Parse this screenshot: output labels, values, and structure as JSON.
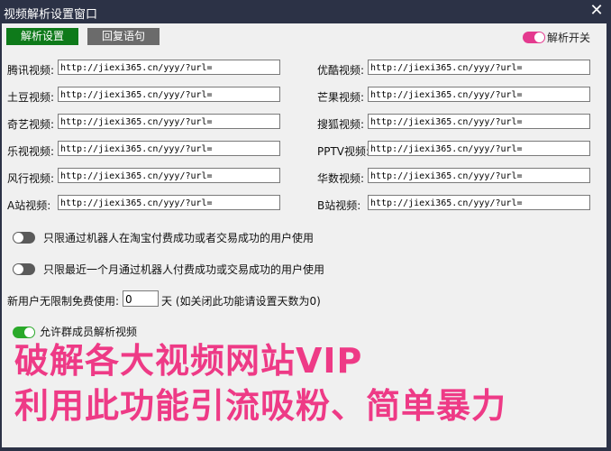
{
  "window": {
    "title": "视频解析设置窗口",
    "close_glyph": "✕"
  },
  "toolbar": {
    "tab_parse": "解析设置",
    "tab_reply": "回复语句",
    "toggle_label": "解析开关"
  },
  "rows": [
    {
      "left_label": "腾讯视频:",
      "left_value": "http://jiexi365.cn/yyy/?url=",
      "right_label": "优酷视频:",
      "right_value": "http://jiexi365.cn/yyy/?url="
    },
    {
      "left_label": "土豆视频:",
      "left_value": "http://jiexi365.cn/yyy/?url=",
      "right_label": "芒果视频:",
      "right_value": "http://jiexi365.cn/yyy/?url="
    },
    {
      "left_label": "奇艺视频:",
      "left_value": "http://jiexi365.cn/yyy/?url=",
      "right_label": "搜狐视频:",
      "right_value": "http://jiexi365.cn/yyy/?url="
    },
    {
      "left_label": "乐视视频:",
      "left_value": "http://jiexi365.cn/yyy/?url=",
      "right_label": "PPTV视频:",
      "right_value": "http://jiexi365.cn/yyy/?url="
    },
    {
      "left_label": "风行视频:",
      "left_value": "http://jiexi365.cn/yyy/?url=",
      "right_label": "华数视频:",
      "right_value": "http://jiexi365.cn/yyy/?url="
    },
    {
      "left_label": "A站视频:",
      "left_value": "http://jiexi365.cn/yyy/?url=",
      "right_label": "B站视频:",
      "right_value": "http://jiexi365.cn/yyy/?url="
    }
  ],
  "options": {
    "opt1": "只限通过机器人在淘宝付费成功或者交易成功的用户使用",
    "opt2": "只限最近一个月通过机器人付费成功或交易成功的用户使用",
    "free_label": "新用户无限制免费使用:",
    "free_value": "0",
    "free_unit": "天 (如关闭此功能请设置天数为0)",
    "allow_group": "允许群成员解析视频"
  },
  "overlay": {
    "line1": "破解各大视频网站VIP",
    "line2": "利用此功能引流吸粉、简单暴力"
  },
  "colors": {
    "accent_pink": "#ee3a86",
    "green": "#0e7a1a",
    "titlebar": "#2c3246"
  }
}
